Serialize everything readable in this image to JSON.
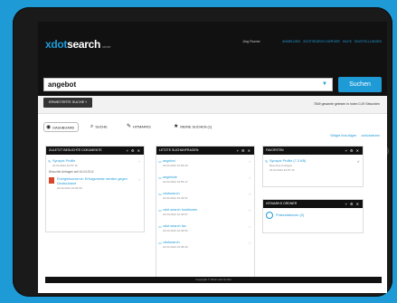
{
  "app": {
    "logo_prefix": "xdot",
    "logo_main": "search",
    "logo_suffix": "server",
    "user": "Jörg Fischer",
    "top_links": [
      "Anmelden",
      "Xdotsearch-Server",
      "Hilfe",
      "Einstellungen"
    ]
  },
  "search": {
    "query": "angebot",
    "dropdown_icon": "chevron-down-icon",
    "button": "Suchen"
  },
  "filter": {
    "extended_search": "Erweiterte Suche",
    "extended_chevron": "˅",
    "result_info": "7849 gesamte gelesen in Index 0.29 Sekunden"
  },
  "tabs": [
    {
      "label": "Dashboard",
      "icon": "dashboard-icon",
      "glyph": "◉"
    },
    {
      "label": "Suche",
      "icon": "search-icon",
      "glyph": "⌕"
    },
    {
      "label": "Hitmarks",
      "icon": "pin-icon",
      "glyph": "✎"
    },
    {
      "label": "Meine Suchen (1)",
      "icon": "star-icon",
      "glyph": "★"
    }
  ],
  "tab_links": [
    "Widget hinzufügen",
    "zurücksetzen"
  ],
  "widgets": {
    "recent_docs": {
      "title": "Zuletzt Besuchte Dokumente",
      "controls": "˅ ⚙ ✕",
      "item": {
        "title": "Synapix Profile",
        "date": "24.04.2012 10:57:16"
      },
      "note": "Besuchte Anfragen seit 16.04.2012",
      "doc": {
        "title": "Energiekonzerne: Erfolgsmeise werden gegen Deutschland",
        "date": "24.04.2012 10:06:59"
      }
    },
    "recent_queries": {
      "title": "Letzte Suchanfragen",
      "controls": "˅ ⚙ ✕",
      "items": [
        {
          "title": "angebot",
          "date": "24.04.2012 10:56:20"
        },
        {
          "title": "angebote",
          "date": "24.04.2012 10:56:17"
        },
        {
          "title": "xdotsearch",
          "date": "24.04.2012 10:43:51"
        },
        {
          "title": "xdot search funktionen",
          "date": "24.04.2012 10:40:07"
        },
        {
          "title": "xdot search fax",
          "date": "24.04.2012 10:39:54"
        },
        {
          "title": "xdotsearch",
          "date": "24.04.2012 10:38:29"
        }
      ]
    },
    "favorites": {
      "title": "Favoriten",
      "controls": "˅ ⚙ ✕",
      "item": {
        "title": "Synapix Profile (7.3 KB)",
        "subtitle": "Besuchte Anfragen",
        "date": "24.04.2012 10:57:16"
      }
    },
    "saved": {
      "title": "Hitmarks Ordner",
      "controls": "˅ ⚙ ✕",
      "item": "Präsentationen (2)"
    }
  },
  "footer": "Copyright © 2012 xdot GmbH"
}
